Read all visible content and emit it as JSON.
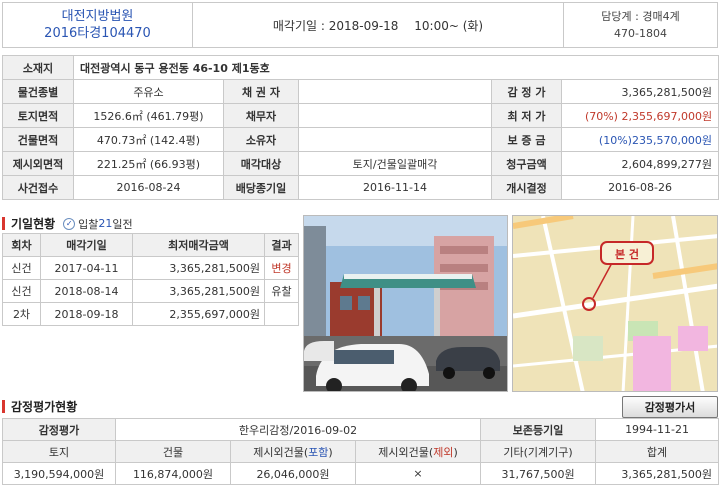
{
  "header": {
    "court": "대전지방법원",
    "case_no": "2016타경104470",
    "sale_date": "매각기일 : 2018-09-18 　10:00~ (화)",
    "dept": "담당계 : 경매4계",
    "phone": "470-1804"
  },
  "info": {
    "location_label": "소재지",
    "location": "대전광역시 동구 용전동 46-10 제1동호",
    "rows": [
      {
        "l1": "물건종별",
        "v1": "주유소",
        "l2": "채 권 자",
        "v2": "",
        "l3": "감 정 가",
        "v3": "3,365,281,500원"
      },
      {
        "l1": "토지면적",
        "v1": "1526.6㎡ (461.79평)",
        "l2": "채무자",
        "v2": "",
        "l3": "최 저 가",
        "v3": "(70%) 2,355,697,000원"
      },
      {
        "l1": "건물면적",
        "v1": "470.73㎡ (142.4평)",
        "l2": "소유자",
        "v2": "",
        "l3": "보 증 금",
        "v3": "(10%)235,570,000원"
      },
      {
        "l1": "제시외면적",
        "v1": "221.25㎡ (66.93평)",
        "l2": "매각대상",
        "v2": "토지/건물일괄매각",
        "l3": "청구금액",
        "v3": "2,604,899,277원"
      },
      {
        "l1": "사건접수",
        "v1": "2016-08-24",
        "l2": "배당종기일",
        "v2": "2016-11-14",
        "l3": "개시결정",
        "v3": "2016-08-26"
      }
    ]
  },
  "history": {
    "title": "기일현황",
    "bid_days_prefix": "입찰",
    "bid_days_num": "21",
    "bid_days_suffix": "일전",
    "headers": [
      "회차",
      "매각기일",
      "최저매각금액",
      "결과"
    ],
    "rows": [
      {
        "round": "신건",
        "date": "2017-04-11",
        "amount": "3,365,281,500원",
        "result": "변경"
      },
      {
        "round": "신건",
        "date": "2018-08-14",
        "amount": "3,365,281,500원",
        "result": "유찰"
      },
      {
        "round": "2차",
        "date": "2018-09-18",
        "amount": "2,355,697,000원",
        "result": ""
      }
    ]
  },
  "map": {
    "marker_label": "본 건"
  },
  "appraisal": {
    "title": "감정평가현황",
    "button": "감정평가서",
    "row1": {
      "l1": "감정평가",
      "v1": "한우리감정/2016-09-02",
      "l2": "보존등기일",
      "v2": "1994-11-21"
    },
    "headers": [
      "토지",
      "건물",
      "제시외건물(포함)",
      "제시외건물(제외)",
      "기타(기계기구)",
      "합계"
    ],
    "values": [
      "3,190,594,000원",
      "116,874,000원",
      "26,046,000원",
      "×",
      "31,767,500원",
      "3,365,281,500원"
    ]
  }
}
